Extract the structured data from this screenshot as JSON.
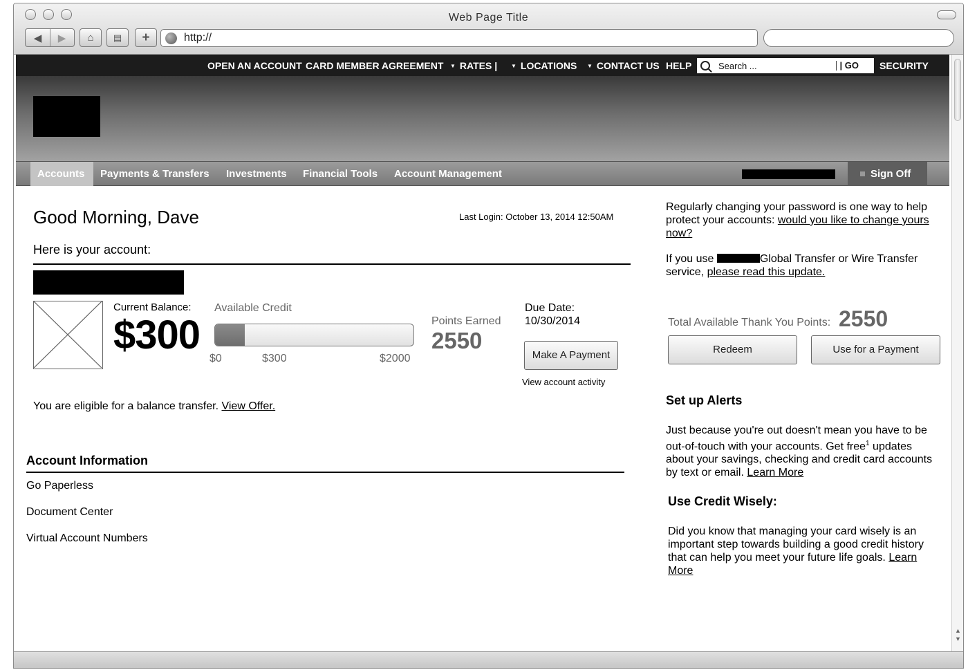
{
  "browser": {
    "window_title": "Web Page Title",
    "url": "http://"
  },
  "topnav": {
    "items": [
      "OPEN AN ACCOUNT",
      "CARD MEMBER AGREEMENT",
      "RATES |",
      "LOCATIONS",
      "CONTACT US",
      "HELP"
    ],
    "search_placeholder": "Search ...",
    "search_go": "| GO",
    "security": "SECURITY"
  },
  "mainnav": {
    "tabs": [
      "Accounts",
      "Payments & Transfers",
      "Investments",
      "Financial Tools",
      "Account Management"
    ],
    "active_tab": "Accounts",
    "sign_off": "Sign Off"
  },
  "greeting": "Good Morning, Dave",
  "last_login": "Last Login: October 13, 2014 12:50AM",
  "account_intro": "Here is your account:",
  "balance": {
    "label": "Current Balance:",
    "value": "$300"
  },
  "available_credit": {
    "label": "Available Credit",
    "min_label": "$0",
    "current_label": "$300",
    "max_label": "$2000",
    "used_fraction": 0.15
  },
  "points": {
    "label": "Points Earned",
    "value": "2550"
  },
  "due": {
    "label": "Due Date:",
    "value": "10/30/2014"
  },
  "make_payment": "Make A Payment",
  "view_activity": "View account activity",
  "balance_transfer": {
    "text": "You are eligible for a balance transfer.",
    "link": "View Offer."
  },
  "account_information": {
    "title": "Account Information",
    "items": [
      "Go Paperless",
      "Document Center",
      "Virtual Account Numbers"
    ]
  },
  "sidebar": {
    "password_text": "Regularly changing your password is one way to help protect your accounts:",
    "password_link": "would you like to change yours now?",
    "transfer_prefix": "If you use",
    "transfer_suffix": "Global Transfer or Wire Transfer service,",
    "transfer_link": "please read this update.",
    "thank_you_label": "Total Available Thank You Points:",
    "thank_you_value": "2550",
    "redeem": "Redeem",
    "use_for_payment": "Use for a Payment",
    "alerts_title": "Set up Alerts",
    "alerts_text_1": "Just because you're out doesn't mean you have to be out-of-touch with your accounts. Get free",
    "alerts_sup": "1",
    "alerts_text_2": "updates about your savings, checking and credit card accounts by text or email.",
    "alerts_link": "Learn More",
    "credit_title": "Use Credit Wisely:",
    "credit_text": "Did you know that managing your card wisely is an important step towards building a good credit history that can help you meet your future life goals.",
    "credit_link": "Learn More"
  }
}
